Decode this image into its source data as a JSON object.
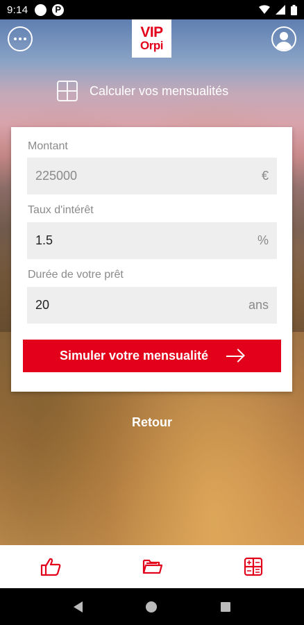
{
  "status_bar": {
    "time": "9:14"
  },
  "header": {
    "logo_line1": "VIP",
    "logo_line2": "Orpi"
  },
  "calculator": {
    "title": "Calculer vos mensualités"
  },
  "form": {
    "amount": {
      "label": "Montant",
      "value": "225000",
      "unit": "€"
    },
    "rate": {
      "label": "Taux d'intérêt",
      "value": "1.5",
      "unit": "%"
    },
    "duration": {
      "label": "Durée de votre prêt",
      "value": "20",
      "unit": "ans"
    },
    "submit_label": "Simuler votre mensualité"
  },
  "back_label": "Retour",
  "colors": {
    "accent": "#e2001a",
    "field_bg": "#eeeeee"
  },
  "tabs": [
    {
      "icon": "thumbs-up-icon"
    },
    {
      "icon": "folder-icon"
    },
    {
      "icon": "calculator-icon"
    }
  ]
}
